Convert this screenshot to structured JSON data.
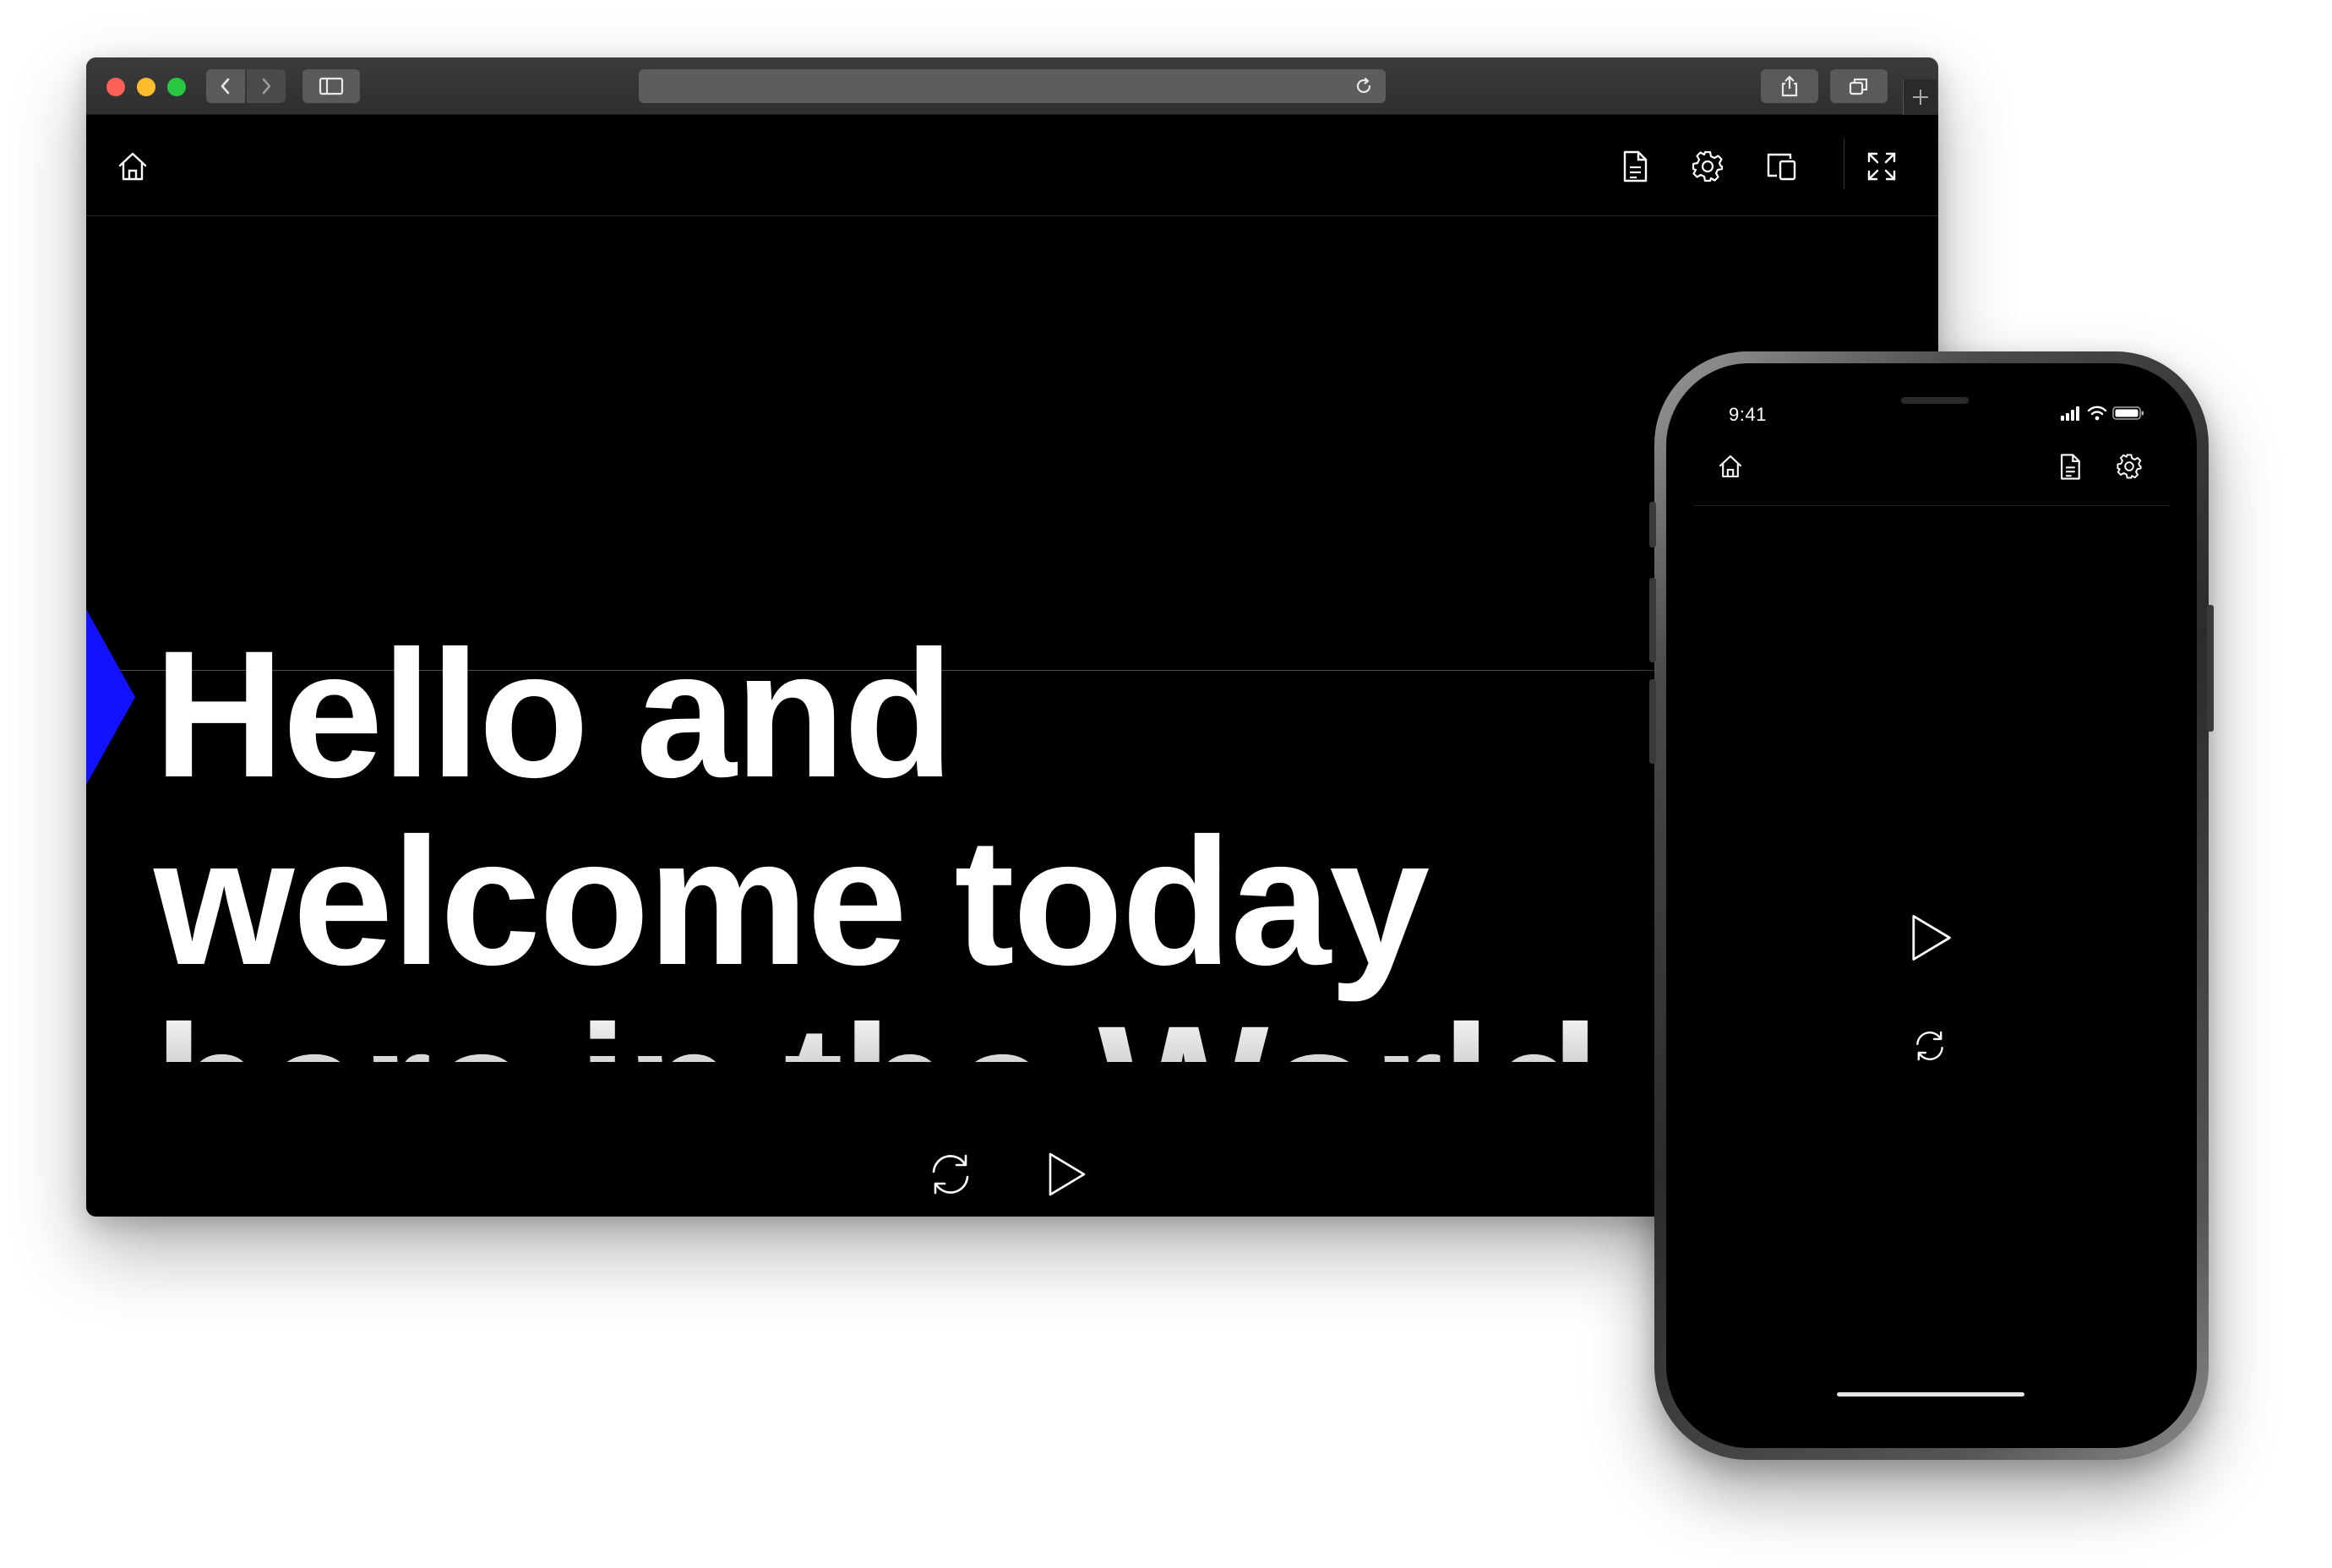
{
  "browser": {
    "url": "",
    "headline_lines": [
      "Hello and",
      "welcome today",
      "here in the World"
    ],
    "accent_color": "#1212ff",
    "icons": {
      "home": "home-icon",
      "document": "document-icon",
      "settings": "gear-icon",
      "devices": "devices-icon",
      "expand": "expand-icon",
      "reset": "reset-icon",
      "play": "play-icon",
      "back": "chevron-left-icon",
      "forward": "chevron-right-icon",
      "sidebar": "sidebar-icon",
      "reload": "reload-icon",
      "share": "share-icon",
      "tabs": "tabs-icon",
      "new_tab": "plus-icon"
    }
  },
  "phone": {
    "status_time": "9:41",
    "icons": {
      "home": "home-icon",
      "document": "document-icon",
      "settings": "gear-icon",
      "play": "play-icon",
      "reset": "reset-icon",
      "signal": "signal-icon",
      "wifi": "wifi-icon",
      "battery": "battery-icon"
    }
  }
}
